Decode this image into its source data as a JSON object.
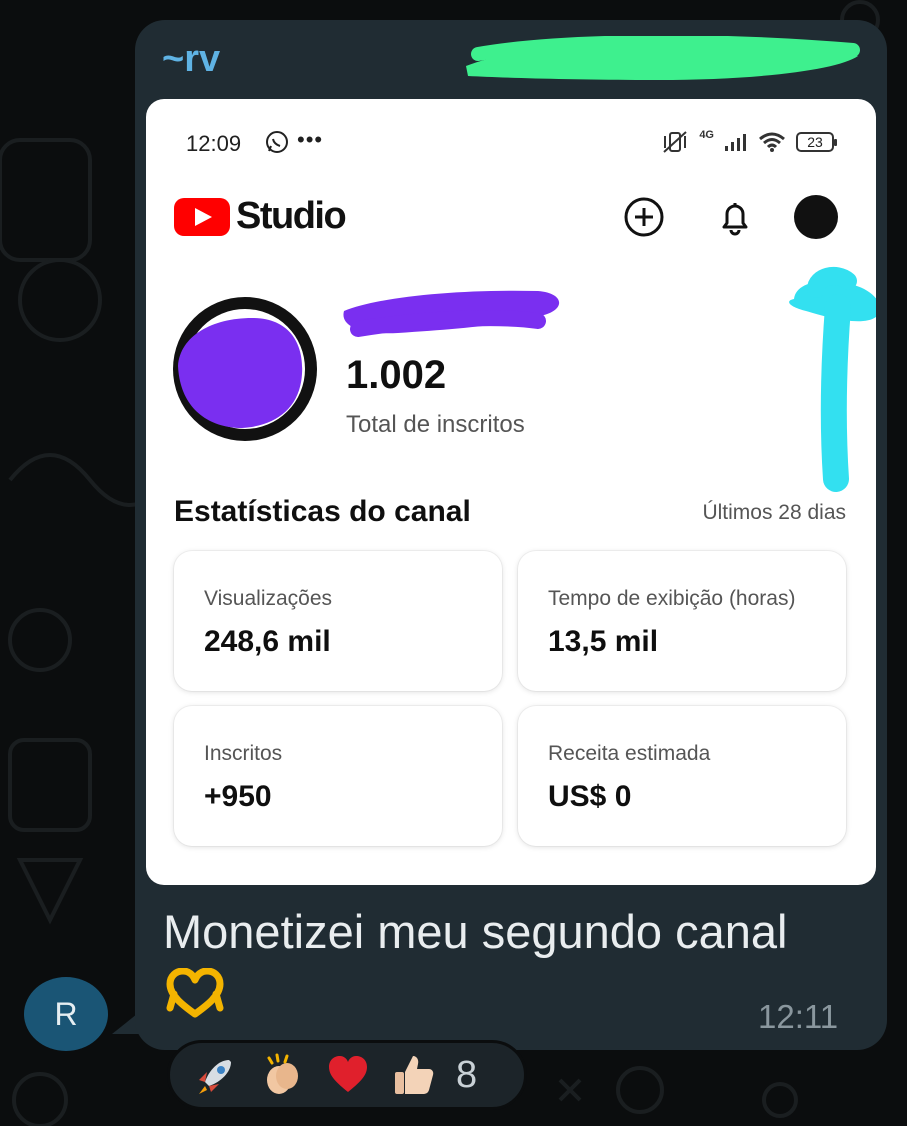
{
  "chat": {
    "sender_name": "~rv",
    "sender_initial": "R",
    "message_text": "Monetizei meu segundo canal",
    "message_emoji": "heart-hands",
    "message_time": "12:11",
    "reactions": [
      "rocket-emoji",
      "clapping-hands-emoji",
      "red-heart-emoji",
      "thumbs-up-emoji"
    ],
    "reaction_count": "8"
  },
  "screenshot": {
    "status_bar": {
      "time": "12:09",
      "network": "4G",
      "battery": "23"
    },
    "app_name": "Studio",
    "subscribers": {
      "count": "1.002",
      "label": "Total de inscritos"
    },
    "stats": {
      "title": "Estatísticas do canal",
      "period": "Últimos 28 dias",
      "cards": [
        {
          "label": "Visualizações",
          "value": "248,6 mil"
        },
        {
          "label": "Tempo de exibição (horas)",
          "value": "13,5 mil"
        },
        {
          "label": "Inscritos",
          "value": "+950"
        },
        {
          "label": "Receita estimada",
          "value": "US$ 0"
        }
      ]
    }
  },
  "colors": {
    "bubble": "#202c33",
    "sender_name": "#5fb3e4",
    "redact_green": "#3ef08e",
    "redact_purple": "#7a2ff0",
    "redact_cyan": "#33e0f0",
    "youtube_red": "#ff0000"
  }
}
